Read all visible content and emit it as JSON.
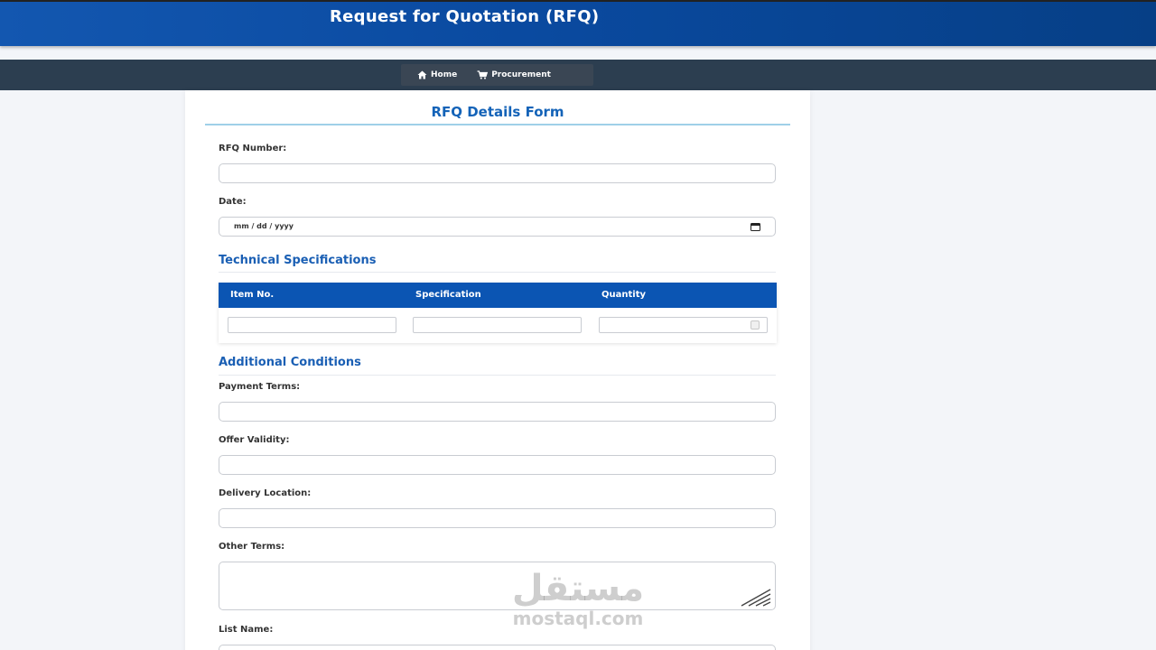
{
  "header": {
    "title": "Request for Quotation (RFQ)"
  },
  "nav": {
    "items": [
      {
        "label": "Home",
        "icon": "home-icon"
      },
      {
        "label": "Procurement",
        "icon": "cart-icon"
      }
    ]
  },
  "form": {
    "title": "RFQ Details Form",
    "rfq_number": {
      "label": "RFQ Number:",
      "value": ""
    },
    "date": {
      "label": "Date:",
      "placeholder": "mm / dd / yyyy",
      "value": ""
    },
    "technical": {
      "title": "Technical Specifications",
      "columns": [
        "Item No.",
        "Specification",
        "Quantity"
      ]
    },
    "additional": {
      "title": "Additional Conditions",
      "payment_terms": {
        "label": "Payment Terms:",
        "value": ""
      },
      "offer_validity": {
        "label": "Offer Validity:",
        "value": ""
      },
      "delivery_location": {
        "label": "Delivery Location:",
        "value": ""
      },
      "other_terms": {
        "label": "Other Terms:",
        "value": ""
      }
    },
    "list_name": {
      "label": "List Name:",
      "value": ""
    }
  },
  "watermark": {
    "arabic": "مستقل",
    "latin": "mostaql.com"
  },
  "colors": {
    "header": "#0a4aa0",
    "nav": "#2c3e50",
    "accent": "#1a5fb4",
    "table_head": "#0b55b3"
  }
}
